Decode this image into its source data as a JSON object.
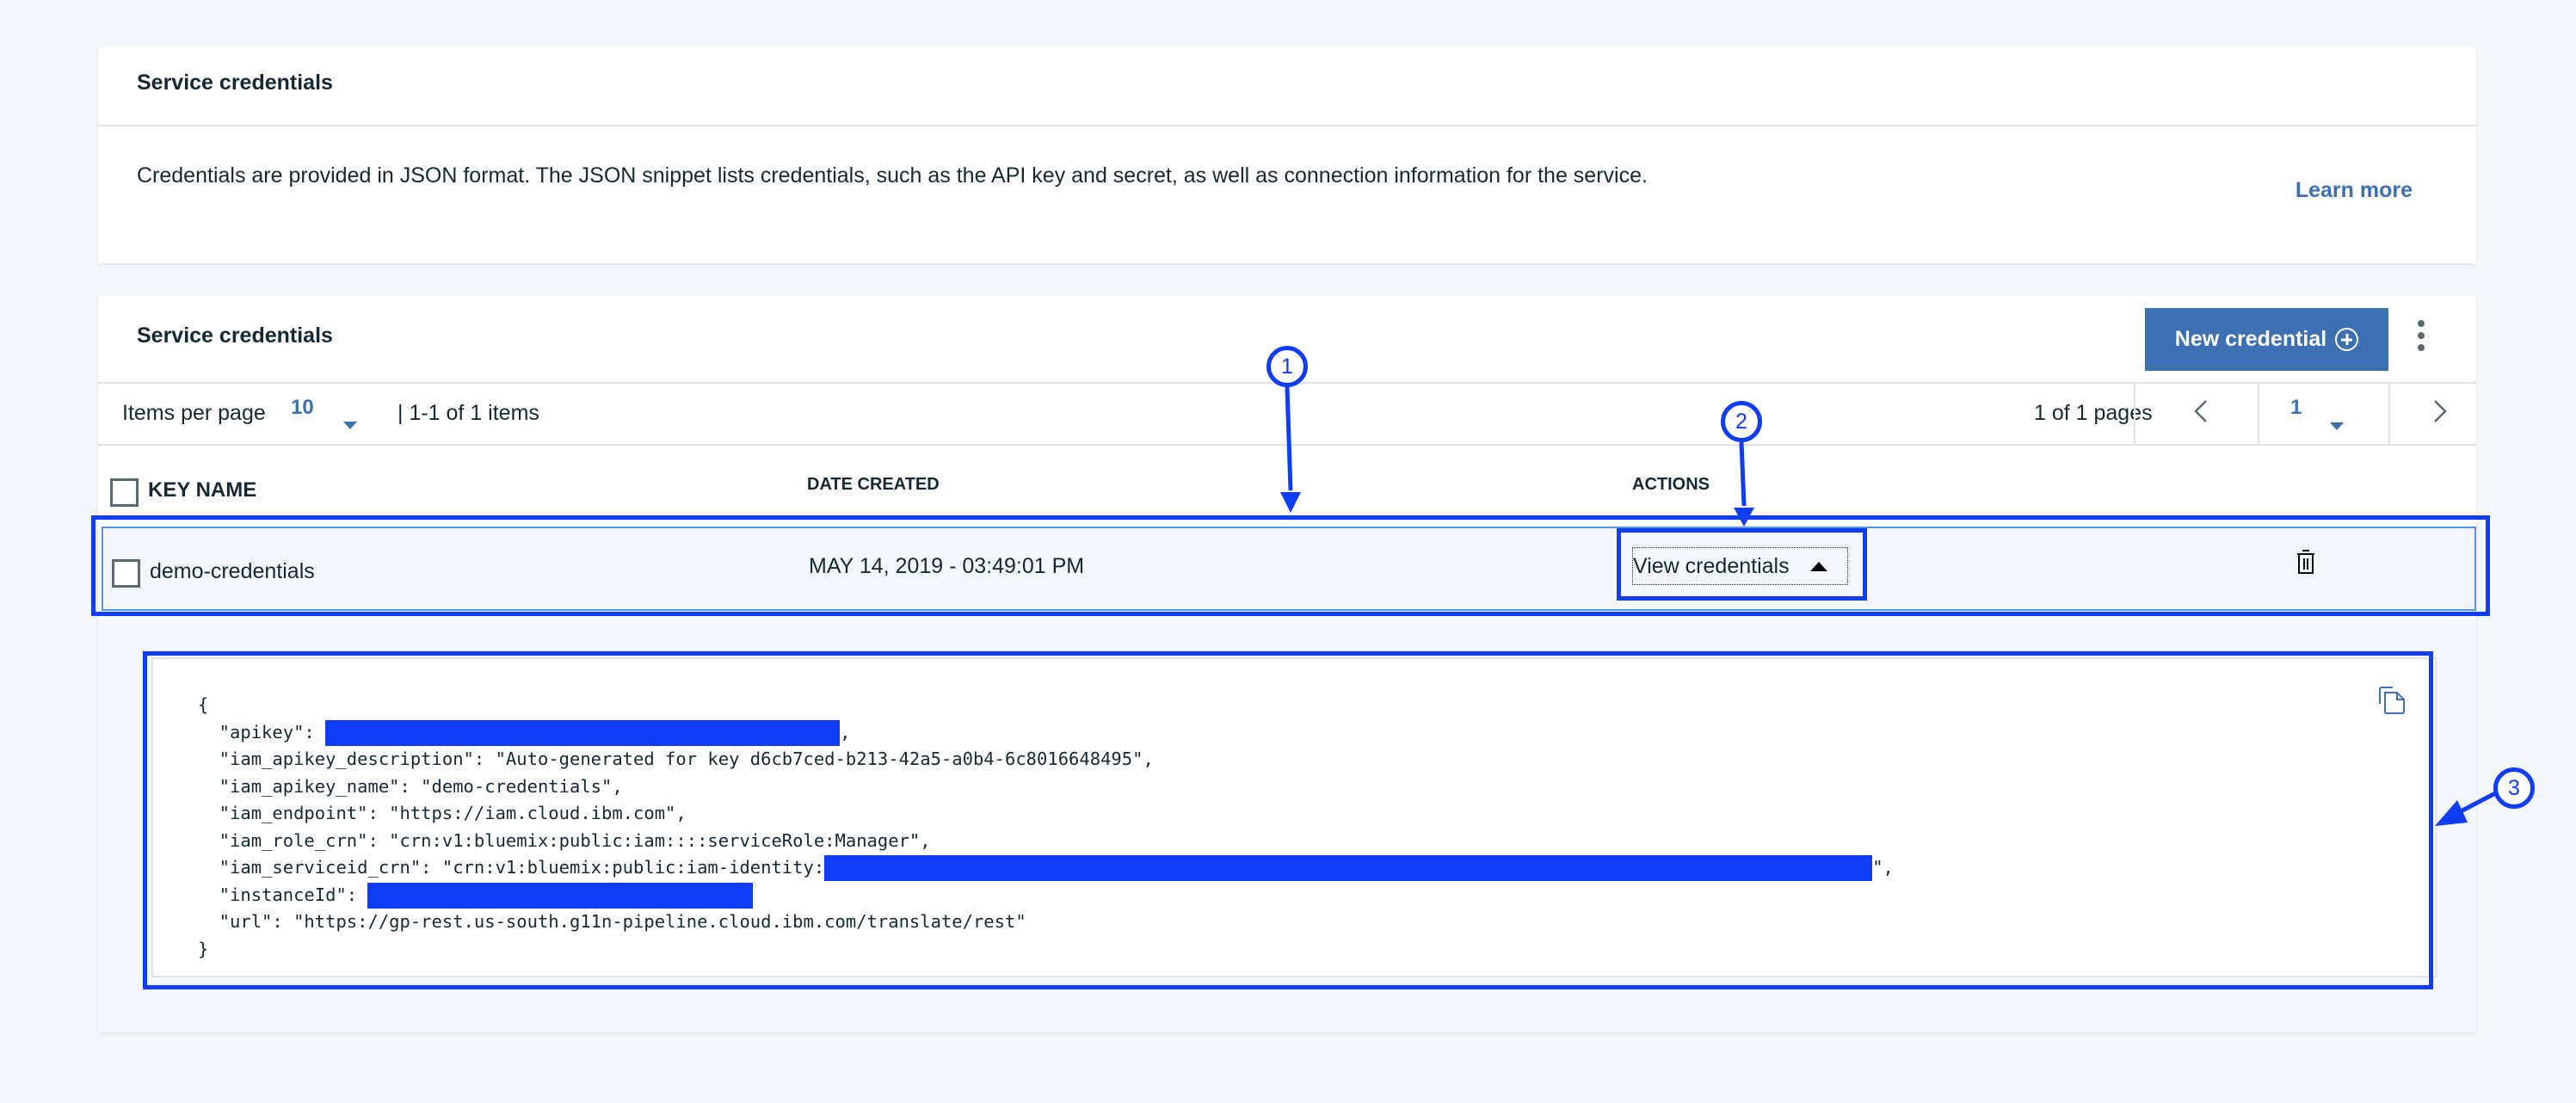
{
  "info_card": {
    "title": "Service credentials",
    "description": "Credentials are provided in JSON format. The JSON snippet lists credentials, such as the API key and secret, as well as connection information for the service.",
    "learn_more": "Learn more"
  },
  "table_card": {
    "title": "Service credentials",
    "new_credential_label": "New credential",
    "pagination": {
      "items_per_page_label": "Items per page",
      "items_per_page_value": "10",
      "items_range": "| 1-1 of 1 items",
      "pages_label": "1 of 1 pages",
      "current_page": "1"
    },
    "columns": {
      "key_name": "KEY NAME",
      "date_created": "DATE CREATED",
      "actions": "ACTIONS"
    },
    "rows": [
      {
        "key_name": "demo-credentials",
        "date_created": "MAY 14, 2019 - 03:49:01 PM",
        "action_label": "View credentials"
      }
    ],
    "credentials_json": {
      "open": "{",
      "close": "}",
      "lines": [
        {
          "prefix": "  \"apikey\": ",
          "redacted": true,
          "suffix": ","
        },
        {
          "prefix": "  \"iam_apikey_description\": \"Auto-generated for key d6cb7ced-b213-42a5-a0b4-6c8016648495\",",
          "redacted": false,
          "suffix": ""
        },
        {
          "prefix": "  \"iam_apikey_name\": \"demo-credentials\",",
          "redacted": false,
          "suffix": ""
        },
        {
          "prefix": "  \"iam_endpoint\": \"https://iam.cloud.ibm.com\",",
          "redacted": false,
          "suffix": ""
        },
        {
          "prefix": "  \"iam_role_crn\": \"crn:v1:bluemix:public:iam::::serviceRole:Manager\",",
          "redacted": false,
          "suffix": ""
        },
        {
          "prefix": "  \"iam_serviceid_crn\": \"crn:v1:bluemix:public:iam-identity:",
          "redacted": true,
          "suffix": "\","
        },
        {
          "prefix": "  \"instanceId\": ",
          "redacted": true,
          "suffix": ""
        },
        {
          "prefix": "  \"url\": \"https://gp-rest.us-south.g11n-pipeline.cloud.ibm.com/translate/rest\"",
          "redacted": false,
          "suffix": ""
        }
      ]
    }
  },
  "annotations": [
    "1",
    "2",
    "3"
  ],
  "colors": {
    "brand_blue": "#3d70b2",
    "annotation_blue": "#0f3cf5",
    "text": "#152935",
    "page_bg": "#f3f6fa"
  }
}
